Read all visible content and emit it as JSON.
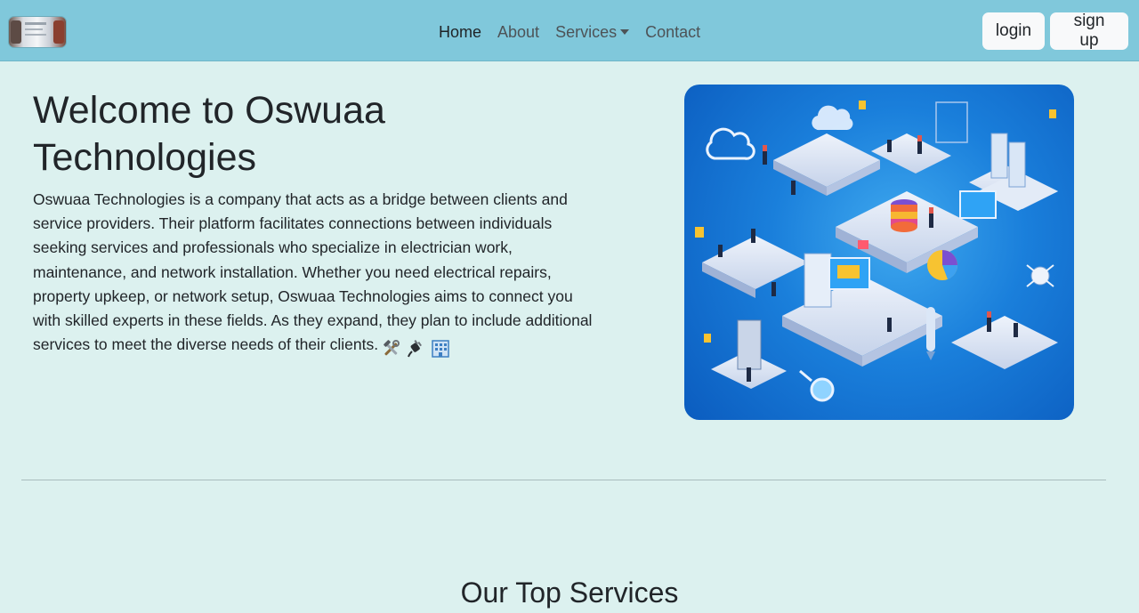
{
  "nav": {
    "links": [
      {
        "label": "Home",
        "active": true
      },
      {
        "label": "About",
        "active": false
      },
      {
        "label": "Services",
        "active": false
      },
      {
        "label": "Contact",
        "active": false
      }
    ],
    "login_label": "login",
    "signup_label": "sign up",
    "background": "#80c8db"
  },
  "hero": {
    "title": "Welcome to Oswuaa Technologies",
    "description": "Oswuaa Technologies is a company that acts as a bridge between clients and service providers. Their platform facilitates connections between individuals seeking services and professionals who specialize in electrician work, maintenance, and network installation. Whether you need electrical repairs, property upkeep, or network setup, Oswuaa Technologies aims to connect you with skilled experts in these fields. As they expand, they plan to include additional services to meet the diverse needs of their clients.",
    "emojis": [
      "hammer-and-wrench-icon",
      "electric-plug-icon",
      "office-building-icon"
    ]
  },
  "services": {
    "title": "Our Top Services"
  },
  "colors": {
    "page_background": "#dcf1ef",
    "navbar": "#80c8db",
    "illustration_blue": "#1a7fdb"
  }
}
